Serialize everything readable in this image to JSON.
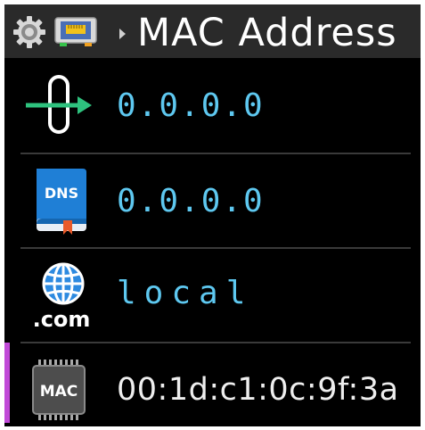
{
  "header": {
    "title": "MAC Address",
    "settings_icon": "gear-icon",
    "network_icon": "network-card-icon"
  },
  "rows": [
    {
      "icon": "ip-address-icon",
      "value": "0.0.0.0"
    },
    {
      "icon": "dns-book-icon",
      "icon_label": "DNS",
      "value": "0.0.0.0"
    },
    {
      "icon": "globe-domain-icon",
      "icon_label": ".com",
      "value": "local"
    },
    {
      "icon": "mac-chip-icon",
      "icon_label": "MAC",
      "value": "00:1d:c1:0c:9f:3a",
      "selected": true
    }
  ],
  "colors": {
    "background": "#000000",
    "titlebar": "#2a2a2a",
    "value_text": "#5ec8f0",
    "mac_text": "#eeeeee",
    "selection": "#c14ad8",
    "divider": "#3a3a3a"
  }
}
